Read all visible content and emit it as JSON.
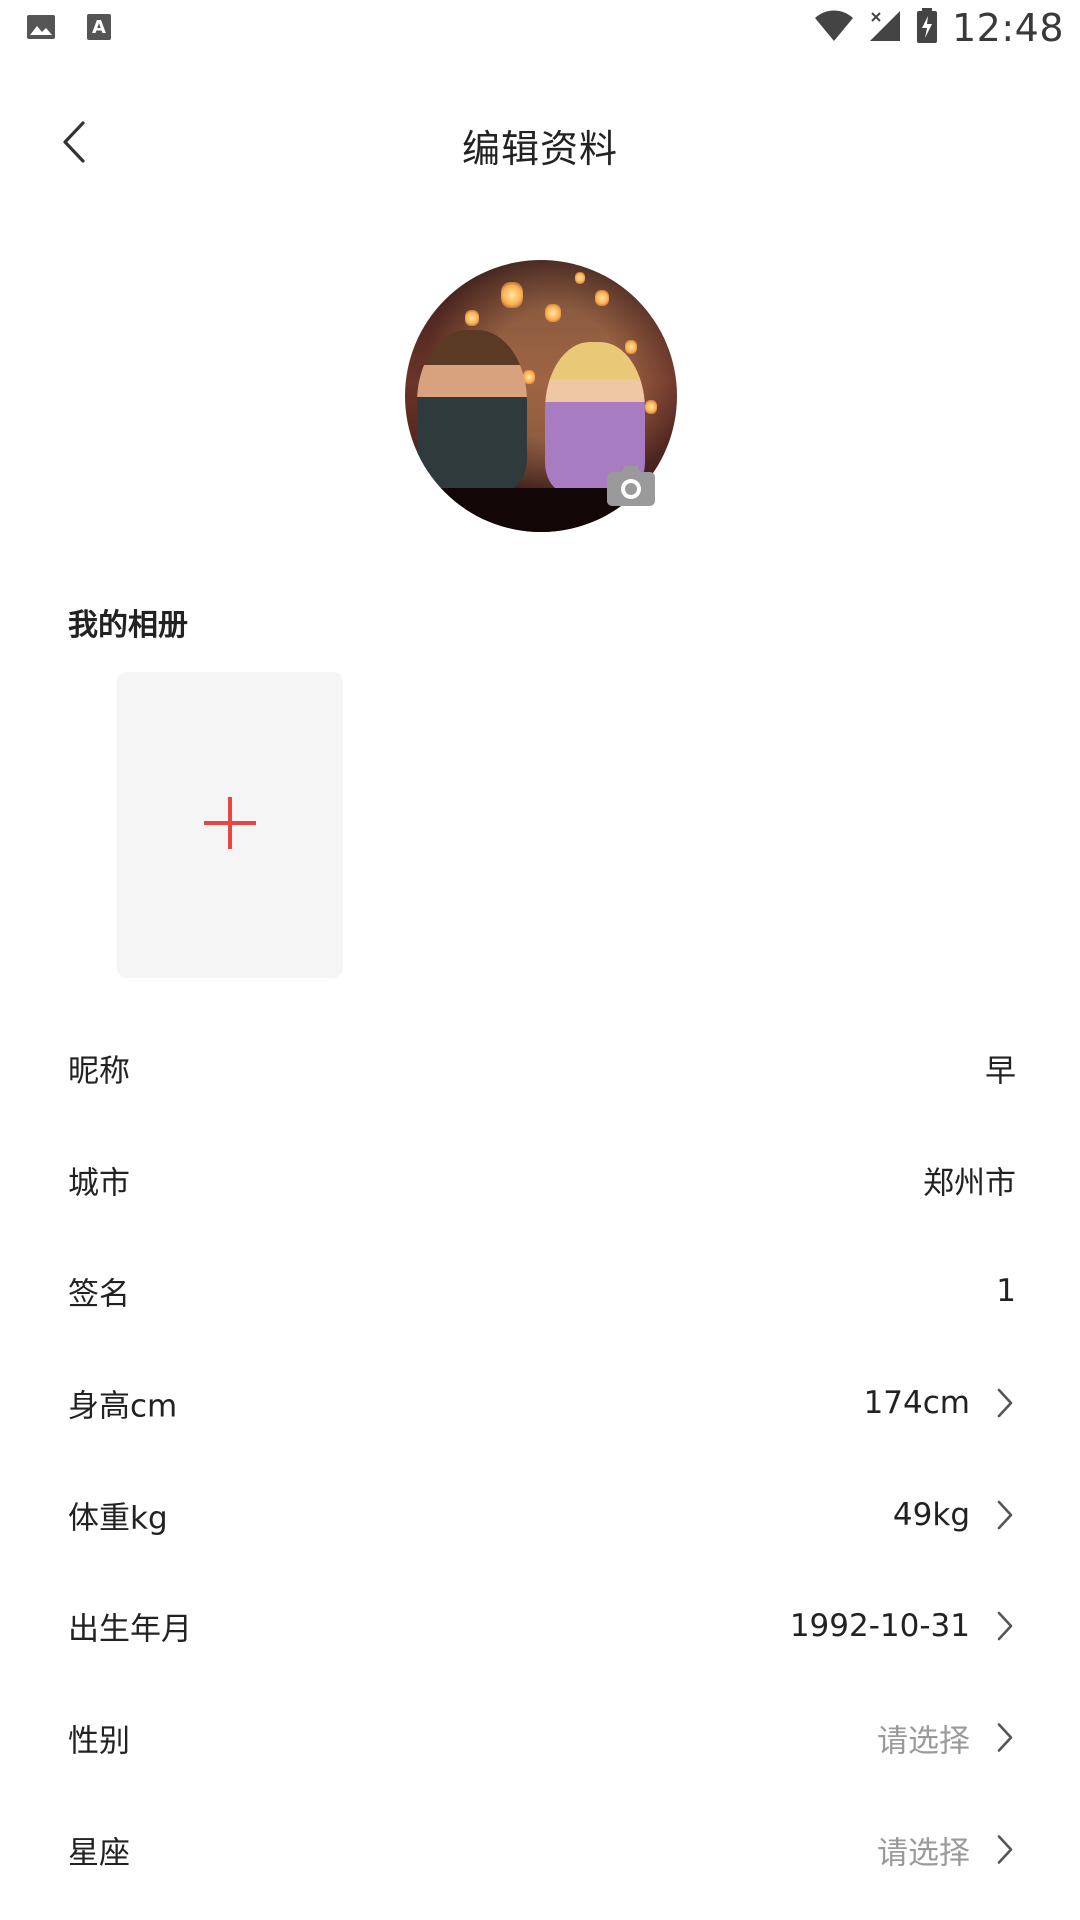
{
  "status_bar": {
    "time": "12:48",
    "left_icons": [
      "image-icon",
      "text-a-icon"
    ],
    "right_icons": [
      "wifi-icon",
      "signal-icon",
      "battery-charging-icon"
    ]
  },
  "header": {
    "title": "编辑资料",
    "back_icon": "chevron-left-icon"
  },
  "avatar": {
    "camera_icon": "camera-icon"
  },
  "album": {
    "title": "我的相册",
    "add_icon": "plus-icon",
    "accent_color": "#e94545"
  },
  "fields": [
    {
      "label": "昵称",
      "value": "早",
      "placeholder": false,
      "chevron": false
    },
    {
      "label": "城市",
      "value": "郑州市",
      "placeholder": false,
      "chevron": false
    },
    {
      "label": "签名",
      "value": "1",
      "placeholder": false,
      "chevron": false
    },
    {
      "label": "身高cm",
      "value": "174cm",
      "placeholder": false,
      "chevron": true
    },
    {
      "label": "体重kg",
      "value": "49kg",
      "placeholder": false,
      "chevron": true
    },
    {
      "label": "出生年月",
      "value": "1992-10-31",
      "placeholder": false,
      "chevron": true
    },
    {
      "label": "性别",
      "value": "请选择",
      "placeholder": true,
      "chevron": true
    },
    {
      "label": "星座",
      "value": "请选择",
      "placeholder": true,
      "chevron": true
    }
  ]
}
